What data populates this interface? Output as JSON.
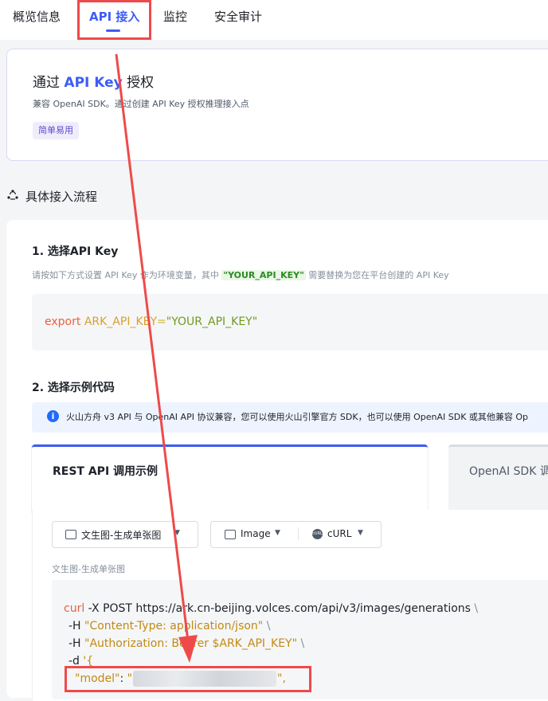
{
  "tabs": {
    "overview": "概览信息",
    "api_access": "API 接入",
    "monitoring": "监控",
    "audit": "安全审计"
  },
  "auth_card": {
    "title_prefix": "通过 ",
    "title_highlight": "API Key",
    "title_suffix": " 授权",
    "description": "兼容 OpenAI SDK。通过创建 API Key 授权推理接入点",
    "badge": "简单易用"
  },
  "flow": {
    "heading": "具体接入流程"
  },
  "step1": {
    "title": "1. 选择API Key",
    "desc_prefix": "请按如下方式设置 API Key 作为环境变量，其中 ",
    "desc_code": "\"YOUR_API_KEY\"",
    "desc_suffix": " 需要替换为您在平台创建的 API Key",
    "code_keyword": "export",
    "code_var": "ARK_API_KEY",
    "code_eq": "=",
    "code_value": "\"YOUR_API_KEY\""
  },
  "step2": {
    "title": "2. 选择示例代码",
    "info_text": "火山方舟 v3 API 与 OpenAI API 协议兼容，您可以使用火山引擎官方 SDK，也可以使用 OpenAI SDK 或其他兼容 Op",
    "tab_rest": "REST API 调用示例",
    "tab_openai": "OpenAI SDK 调",
    "selector_task": "文生图-生成单张图",
    "selector_type": "Image",
    "selector_lang": "cURL",
    "curl_icon_text": "cURL",
    "sub_label": "文生图-生成单张图",
    "code": {
      "line1_cmd": "curl",
      "line1_opt": " -X POST ",
      "line1_url": "https://ark.cn-beijing.volces.com/api/v3/images/generations",
      "line1_bs": " \\",
      "line2_opt": "-H ",
      "line2_str": "\"Content-Type: application/json\"",
      "line2_bs": " \\",
      "line3_opt": "-H ",
      "line3_str": "\"Authorization: Bearer $ARK_API_KEY\"",
      "line3_bs": " \\",
      "line4_opt": "-d ",
      "line4_str": "'{",
      "line5_key": "\"model\"",
      "line5_colon": ": ",
      "line5_quote_open": "\"",
      "line5_end": "\","
    }
  },
  "colors": {
    "accent": "#3d5cf5",
    "annotation": "#ef4a4a"
  }
}
